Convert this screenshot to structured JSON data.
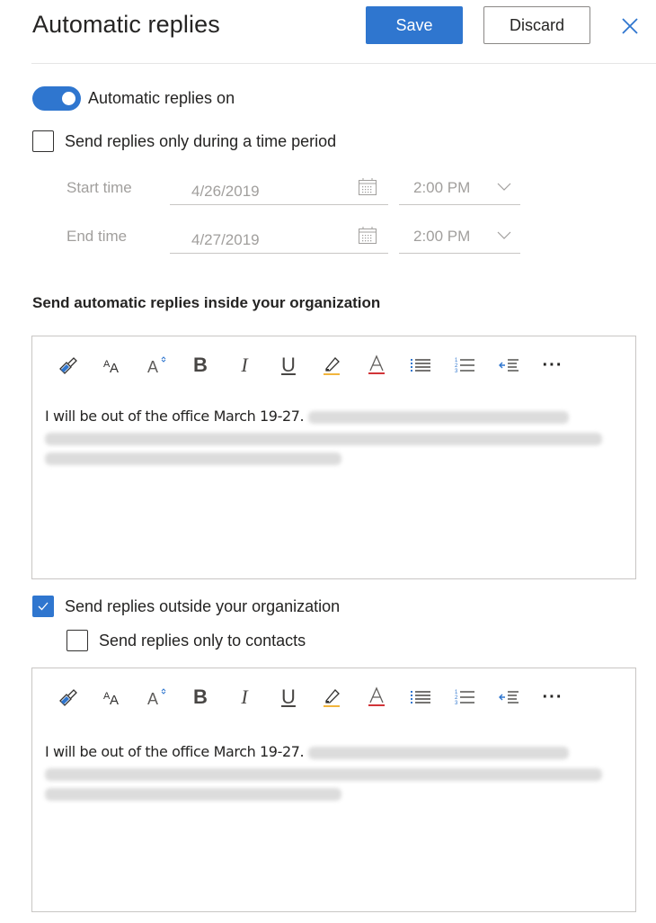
{
  "header": {
    "title": "Automatic replies",
    "save_label": "Save",
    "discard_label": "Discard",
    "close_icon": "close-icon"
  },
  "colors": {
    "accent": "#2f76cf",
    "highlight_underline": "#f2b53d",
    "font_color_underline": "#d13438"
  },
  "toggle": {
    "label": "Automatic replies on",
    "on": true
  },
  "time_period": {
    "label": "Send replies only during a time period",
    "checked": false,
    "start": {
      "label": "Start time",
      "date": "4/26/2019",
      "time": "2:00 PM"
    },
    "end": {
      "label": "End time",
      "date": "4/27/2019",
      "time": "2:00 PM"
    }
  },
  "inside": {
    "section_title": "Send automatic replies inside your organization",
    "message_visible": "I will be out of the office March 19-27.",
    "message_redacted": true
  },
  "outside": {
    "label": "Send replies outside your organization",
    "checked": true,
    "contacts_only_label": "Send replies only to contacts",
    "contacts_only_checked": false,
    "message_visible": "I will be out of the office March 19-27.",
    "message_redacted": true
  },
  "toolbar": {
    "items": [
      {
        "name": "format-painter-icon",
        "tooltip": "Format painter"
      },
      {
        "name": "font-size-icon",
        "tooltip": "Font size"
      },
      {
        "name": "grow-font-icon",
        "tooltip": "Grow font"
      },
      {
        "name": "bold-icon",
        "glyph": "B"
      },
      {
        "name": "italic-icon",
        "glyph": "I"
      },
      {
        "name": "underline-icon",
        "glyph": "U"
      },
      {
        "name": "highlight-icon",
        "tooltip": "Highlight"
      },
      {
        "name": "font-color-icon",
        "glyph": "A"
      },
      {
        "name": "bullets-icon",
        "tooltip": "Bullets"
      },
      {
        "name": "numbering-icon",
        "tooltip": "Numbering"
      },
      {
        "name": "decrease-indent-icon",
        "tooltip": "Decrease indent"
      },
      {
        "name": "more-options-icon",
        "glyph": "···"
      }
    ]
  }
}
